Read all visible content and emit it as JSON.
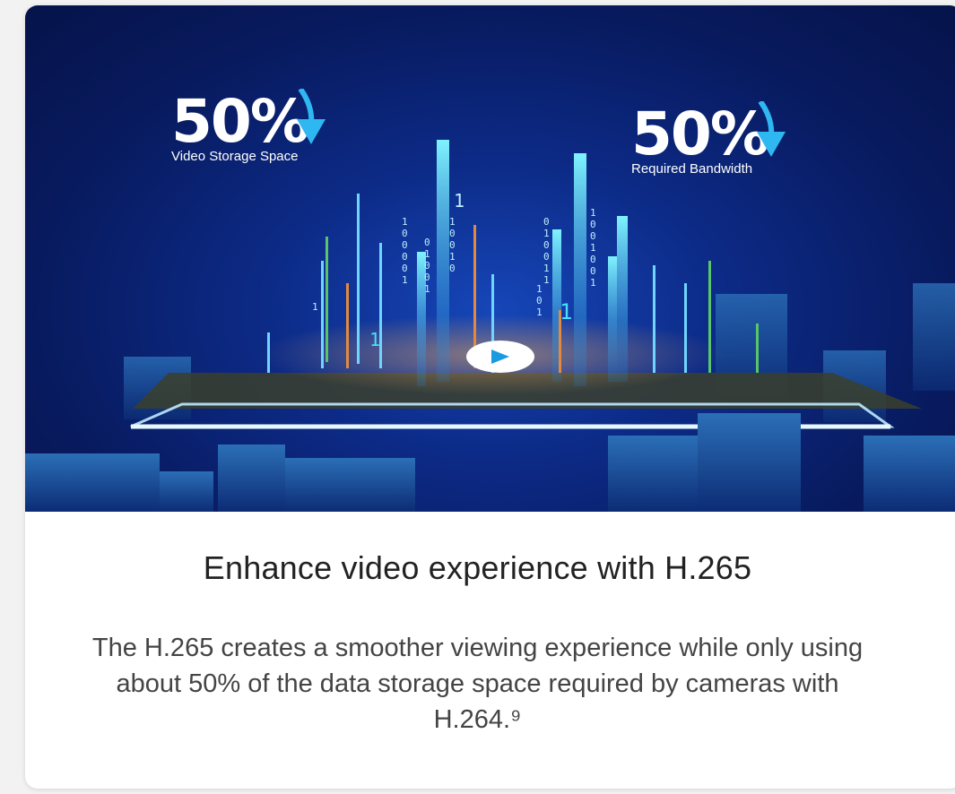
{
  "hero": {
    "stat_left": {
      "value": "50%",
      "label": "Video Storage Space"
    },
    "stat_right": {
      "value": "50%",
      "label": "Required Bandwidth"
    }
  },
  "card": {
    "title": "Enhance video experience with H.265",
    "description": "The H.265 creates a smoother viewing experience while only using about 50% of the data storage space required by cameras with H.264.⁹"
  }
}
